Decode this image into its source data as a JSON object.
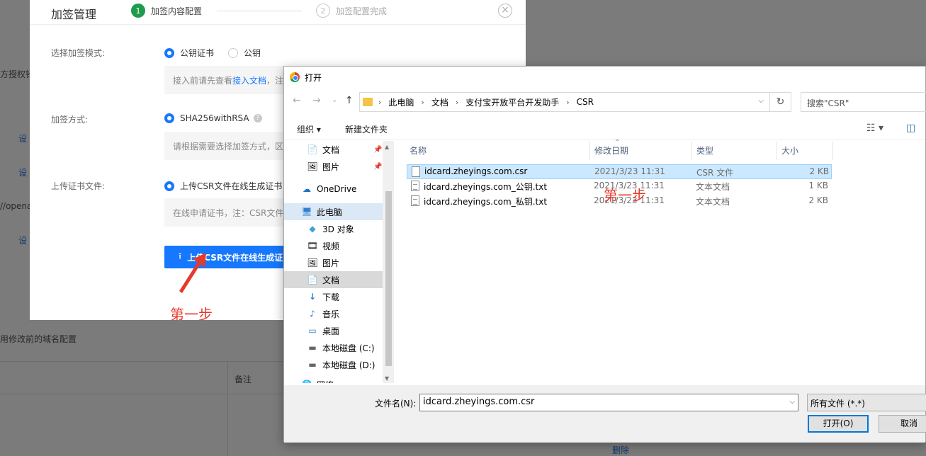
{
  "background": {
    "fragments": [
      "方授权针",
      "设",
      "设",
      "//opena",
      "设"
    ],
    "note": "用修改前的域名配置",
    "column_header": "备注",
    "bottom_link": "删除"
  },
  "modal": {
    "title": "加签管理",
    "step1_number": "1",
    "step1_label": "加签内容配置",
    "step2_number": "2",
    "step2_label": "加签配置完成",
    "close_icon": "×",
    "mode_label": "选择加签模式:",
    "mode_option_cert": "公钥证书",
    "mode_option_key": "公钥",
    "mode_hint_prefix": "接入前请先查看",
    "mode_hint_link": "接入文档",
    "mode_hint_suffix": "，注",
    "method_label": "加签方式:",
    "method_option": "SHA256withRSA",
    "method_help": "?",
    "method_hint": "请根据需要选择加签方式，区",
    "upload_label": "上传证书文件:",
    "upload_option": "上传CSR文件在线生成证书",
    "upload_hint": "在线申请证书，注：CSR文件",
    "upload_button": "上传CSR文件在线生成证",
    "upload_icon": "⭱"
  },
  "annotations": {
    "step_text": "第一步"
  },
  "dialog": {
    "title": "打开",
    "nav": {
      "back": "←",
      "forward": "→",
      "history": "⌄",
      "up": "↑"
    },
    "breadcrumb": [
      "此电脑",
      "文档",
      "支付宝开放平台开发助手",
      "CSR"
    ],
    "refresh_icon": "↻",
    "search_placeholder": "搜索\"CSR\"",
    "organize": "组织 ▾",
    "new_folder": "新建文件夹",
    "view_icon": "☷ ▾",
    "pane_icon": "◫",
    "nav_items": [
      {
        "label": "文档",
        "icon": "📄",
        "pinned": true
      },
      {
        "label": "图片",
        "icon": "🖼",
        "pinned": true
      },
      {
        "label": "OneDrive",
        "icon": "☁"
      },
      {
        "label": "此电脑",
        "icon": "🖥"
      },
      {
        "label": "3D 对象",
        "icon": "◆"
      },
      {
        "label": "视频",
        "icon": "🎞"
      },
      {
        "label": "图片",
        "icon": "🖼"
      },
      {
        "label": "文档",
        "icon": "📄"
      },
      {
        "label": "下载",
        "icon": "↓"
      },
      {
        "label": "音乐",
        "icon": "♪"
      },
      {
        "label": "桌面",
        "icon": "▭"
      },
      {
        "label": "本地磁盘 (C:)",
        "icon": "▬"
      },
      {
        "label": "本地磁盘 (D:)",
        "icon": "▬"
      },
      {
        "label": "网络",
        "icon": "🌐"
      }
    ],
    "columns": [
      "名称",
      "修改日期",
      "类型",
      "大小"
    ],
    "files": [
      {
        "name": "idcard.zheyings.com.csr",
        "date": "2021/3/23 11:31",
        "type": "CSR 文件",
        "size": "2 KB"
      },
      {
        "name": "idcard.zheyings.com_公钥.txt",
        "date": "2021/3/23 11:31",
        "type": "文本文档",
        "size": "1 KB"
      },
      {
        "name": "idcard.zheyings.com_私钥.txt",
        "date": "2021/3/23 11:31",
        "type": "文本文档",
        "size": "2 KB"
      }
    ],
    "filename_label": "文件名(N):",
    "filename_value": "idcard.zheyings.com.csr",
    "filetype_value": "所有文件 (*.*)",
    "open_button": "打开(O)",
    "cancel_button": "取消"
  },
  "colors": {
    "accent": "#1677ff",
    "step_active": "#1f9b4d",
    "annotation": "#e53a2c",
    "selection": "#cce8ff"
  }
}
